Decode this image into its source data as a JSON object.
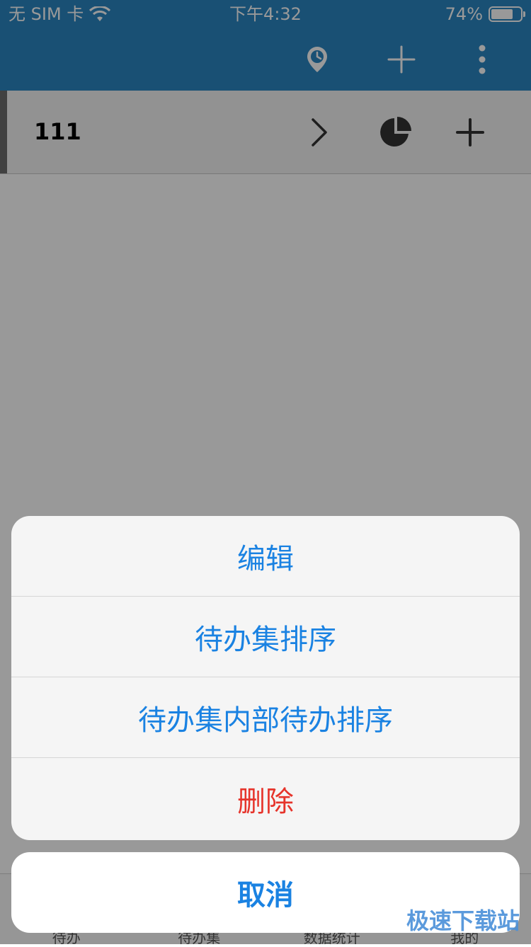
{
  "status_bar": {
    "carrier": "无 SIM 卡",
    "time": "下午4:32",
    "battery_percent": "74%",
    "battery_level": 0.74,
    "wifi_icon": "wifi-icon"
  },
  "nav_bar": {
    "icons": [
      "clock-pin-icon",
      "plus-icon",
      "more-vertical-icon"
    ]
  },
  "group_row": {
    "title": "111",
    "icons": [
      "chevron-right-icon",
      "pie-chart-icon",
      "plus-icon"
    ]
  },
  "tab_bar": {
    "tabs": [
      {
        "label": "待办"
      },
      {
        "label": "待办集"
      },
      {
        "label": "数据统计"
      },
      {
        "label": "我的"
      }
    ]
  },
  "action_sheet": {
    "items": [
      {
        "label": "编辑"
      },
      {
        "label": "待办集排序"
      },
      {
        "label": "待办集内部待办排序"
      },
      {
        "label": "删除"
      }
    ],
    "cancel_label": "取消"
  },
  "watermark": "极速下载站",
  "colors": {
    "header_blue": "#2a86c2",
    "action_blue": "#1a82e2",
    "destructive_red": "#e6342b"
  }
}
